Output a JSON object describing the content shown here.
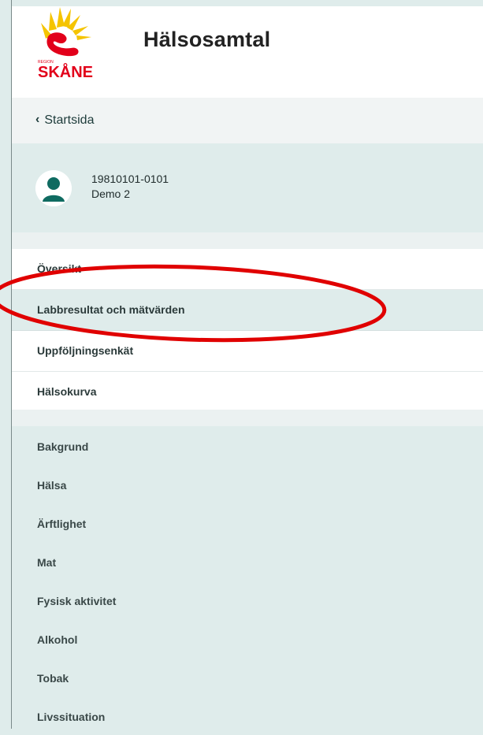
{
  "header": {
    "app_title": "Hälsosamtal",
    "logo": {
      "small_text": "REGION",
      "name": "SKÅNE",
      "colors": {
        "sun": "#f5c400",
        "red": "#e2001a"
      }
    }
  },
  "back": {
    "label": "Startsida"
  },
  "patient": {
    "id": "19810101-0101",
    "name": "Demo 2"
  },
  "nav_primary": [
    {
      "label": "Översikt",
      "active": false
    },
    {
      "label": "Labbresultat och mätvärden",
      "active": true
    },
    {
      "label": "Uppföljningsenkät",
      "active": false
    },
    {
      "label": "Hälsokurva",
      "active": false
    }
  ],
  "nav_sections": [
    {
      "label": "Bakgrund"
    },
    {
      "label": "Hälsa"
    },
    {
      "label": "Ärftlighet"
    },
    {
      "label": "Mat"
    },
    {
      "label": "Fysisk aktivitet"
    },
    {
      "label": "Alkohol"
    },
    {
      "label": "Tobak"
    },
    {
      "label": "Livssituation"
    }
  ],
  "annotation": {
    "color": "#e00000"
  }
}
